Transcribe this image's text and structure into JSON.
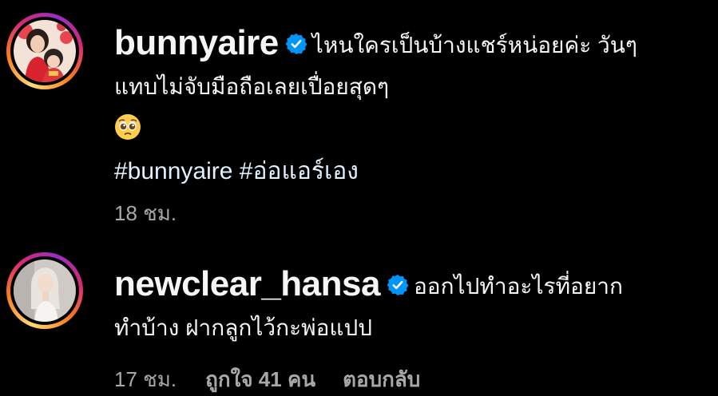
{
  "comments": [
    {
      "username": "bunnyaire",
      "verified": true,
      "text_line1": "ไหนใครเป็นบ้างแชร์หน่อยค่ะ วันๆ",
      "text_line2": "แทบไม่จับมือถือเลยเปื่อยสุดๆ",
      "emoji": "pleading-face-emoji",
      "hashtags": "#bunnyaire #อ่อแอร์เอง",
      "time": "18 ชม."
    },
    {
      "username": "newclear_hansa",
      "verified": true,
      "text_line1": "ออกไปทำอะไรที่อยาก",
      "text_line2": "ทำบ้าง ฝากลูกไว้กะพ่อแปป",
      "time": "17 ชม.",
      "likes": "ถูกใจ 41 คน",
      "reply_label": "ตอบกลับ"
    }
  ],
  "colors": {
    "background": "#000000",
    "text": "#f5f5f5",
    "secondary": "#a8a8a8",
    "verified_blue": "#0095f6"
  }
}
